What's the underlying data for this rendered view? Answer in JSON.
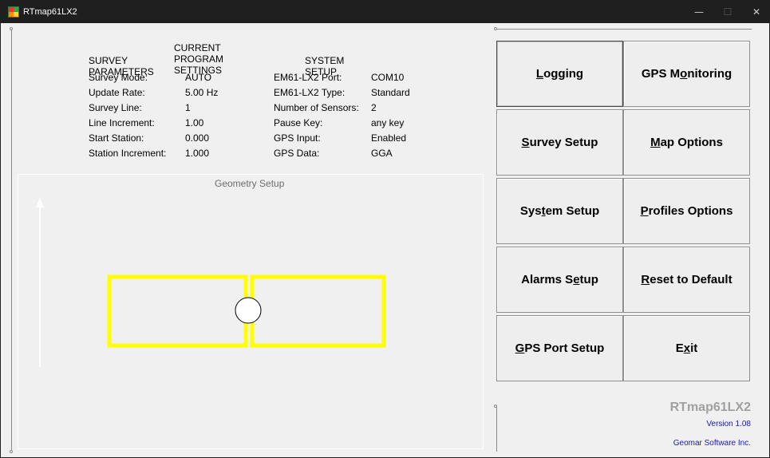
{
  "window": {
    "title": "RTmap61LX2",
    "controls": {
      "minimize": "—",
      "maximize": "☐",
      "close": "✕"
    }
  },
  "settings": {
    "title": "CURRENT PROGRAM SETTINGS",
    "survey": {
      "header": "SURVEY PARAMETERS",
      "rows": [
        {
          "label": "Survey Mode:",
          "value": "AUTO"
        },
        {
          "label": "Update Rate:",
          "value": "5.00 Hz"
        },
        {
          "label": "Survey Line:",
          "value": "1"
        },
        {
          "label": "Line Increment:",
          "value": "1.00"
        },
        {
          "label": "Start Station:",
          "value": "0.000"
        },
        {
          "label": "Station Increment:",
          "value": "1.000"
        }
      ]
    },
    "system": {
      "header": "SYSTEM SETUP",
      "rows": [
        {
          "label": "EM61-LX2 Port:",
          "value": "COM10"
        },
        {
          "label": "EM61-LX2 Type:",
          "value": "Standard"
        },
        {
          "label": "Number of Sensors:",
          "value": "2"
        },
        {
          "label": "Pause Key:",
          "value": "any key"
        },
        {
          "label": "GPS Input:",
          "value": "Enabled"
        },
        {
          "label": "GPS Data:",
          "value": "GGA"
        }
      ]
    }
  },
  "geometry": {
    "title": "Geometry Setup",
    "coil_color": "#ffff00",
    "arrow_icon": "direction-arrow-icon",
    "gps_icon": "gps-antenna-circle-icon"
  },
  "buttons": [
    {
      "name": "logging-button",
      "pre": "",
      "ul": "L",
      "post": "ogging",
      "focused": true
    },
    {
      "name": "gps-monitoring-button",
      "pre": "GPS M",
      "ul": "o",
      "post": "nitoring",
      "focused": false
    },
    {
      "name": "survey-setup-button",
      "pre": "",
      "ul": "S",
      "post": "urvey Setup",
      "focused": false
    },
    {
      "name": "map-options-button",
      "pre": "",
      "ul": "M",
      "post": "ap Options",
      "focused": false
    },
    {
      "name": "system-setup-button",
      "pre": "Sys",
      "ul": "t",
      "post": "em Setup",
      "focused": false
    },
    {
      "name": "profiles-options-button",
      "pre": "",
      "ul": "P",
      "post": "rofiles Options",
      "focused": false
    },
    {
      "name": "alarms-setup-button",
      "pre": "Alarms S",
      "ul": "e",
      "post": "tup",
      "focused": false
    },
    {
      "name": "reset-to-default-button",
      "pre": "",
      "ul": "R",
      "post": "eset to Default",
      "focused": false
    },
    {
      "name": "gps-port-setup-button",
      "pre": "",
      "ul": "G",
      "post": "PS Port Setup",
      "focused": false
    },
    {
      "name": "exit-button",
      "pre": "E",
      "ul": "x",
      "post": "it",
      "focused": false
    }
  ],
  "footer": {
    "app_name": "RTmap61LX2",
    "version": "Version 1.08",
    "company": "Geomar Software Inc."
  }
}
